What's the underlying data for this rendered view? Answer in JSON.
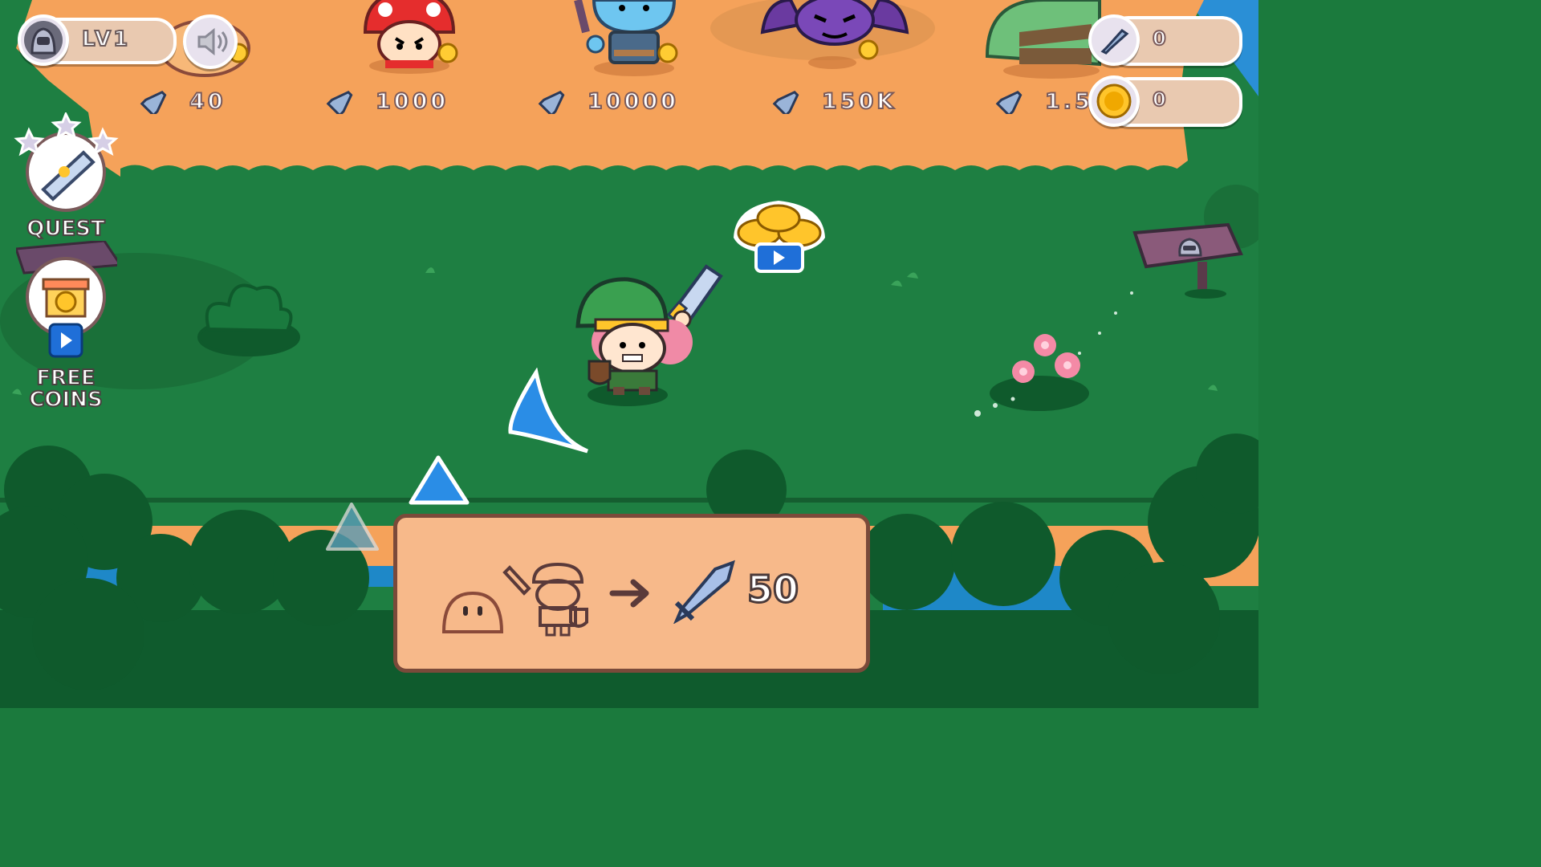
{
  "hud": {
    "level_label": "LV1",
    "sword_count": "0",
    "coin_count": "0"
  },
  "enemies": [
    {
      "name": "slug",
      "price": "40"
    },
    {
      "name": "mushroom",
      "price": "1000"
    },
    {
      "name": "blue-goblin",
      "price": "10000"
    },
    {
      "name": "bat",
      "price": "150K"
    },
    {
      "name": "green-ogre",
      "price": "1.5"
    }
  ],
  "side": {
    "quest_label": "QUEST",
    "free_label_line1": "FREE",
    "free_label_line2": "COINS"
  },
  "hint": {
    "reward_value": "50"
  },
  "colors": {
    "grass": "#1b7a3d",
    "sand": "#f5a560",
    "panel": "#f7b98a",
    "panel_border": "#7a4a3a",
    "water": "#1e88c8"
  },
  "icons": [
    "player-avatar-icon",
    "sound-icon",
    "sword-icon",
    "coin-icon",
    "scroll-icon",
    "gift-icon",
    "video-icon",
    "signpost-icon",
    "arrow-right-icon",
    "slime-icon",
    "hero-icon"
  ]
}
